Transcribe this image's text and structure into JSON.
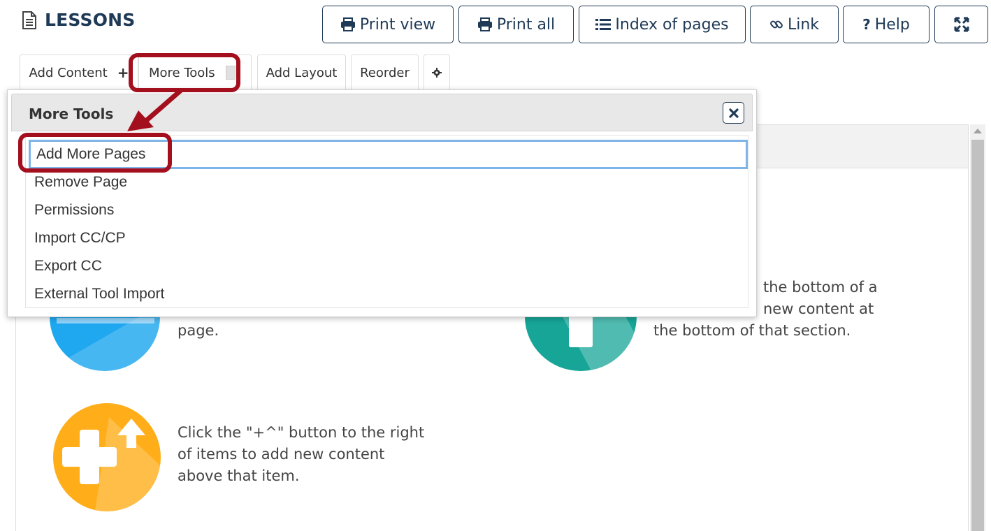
{
  "page_title": "LESSONS",
  "top_buttons": {
    "print_view": "Print view",
    "print_all": "Print all",
    "index_of_pages": "Index of pages",
    "link": "Link",
    "help": "Help"
  },
  "toolbar": {
    "add_content": "Add Content",
    "add_content_plus": "+",
    "more_tools": "More Tools",
    "add_layout": "Add Layout",
    "reorder": "Reorder"
  },
  "dropdown": {
    "title": "More Tools",
    "items": [
      "Add More Pages",
      "Remove Page",
      "Permissions",
      "Import CC/CP",
      "Export CC",
      "External Tool Import"
    ]
  },
  "help_texts": {
    "left_fragment": "page.",
    "right_fragment_1": "the bottom of a",
    "right_fragment_2": "new content at",
    "right_fragment_3": "the bottom of that section.",
    "bottom_1": "Click the \"+^\" button to the right",
    "bottom_2": "of items to add new content",
    "bottom_3": "above that item."
  },
  "colors": {
    "accent_navy": "#1f3a56",
    "annotation_red": "#a40f1e",
    "circle_blue": "#1fa8f0",
    "circle_teal": "#16a597",
    "circle_orange": "#ffae1a",
    "focus_blue": "#7fb4e8"
  }
}
